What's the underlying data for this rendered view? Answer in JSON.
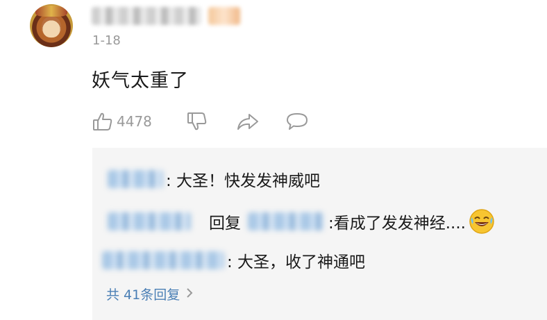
{
  "comment": {
    "time": "1-18",
    "text": "妖气太重了",
    "like_count": "4478"
  },
  "replies": [
    {
      "suffix": ": 大圣！快发发神威吧"
    },
    {
      "reply_word": "回复",
      "suffix": ":看成了发发神经...."
    },
    {
      "suffix": ": 大圣，收了神通吧"
    }
  ],
  "more_replies_label": "共 41条回复",
  "colors": {
    "link": "#4a7fb5",
    "muted": "#999999",
    "reply_bg": "#f5f5f5"
  },
  "icons": [
    "thumbs-up-icon",
    "thumbs-down-icon",
    "share-icon",
    "comment-icon",
    "chevron-right-icon",
    "laughing-tears-emoji-icon"
  ]
}
